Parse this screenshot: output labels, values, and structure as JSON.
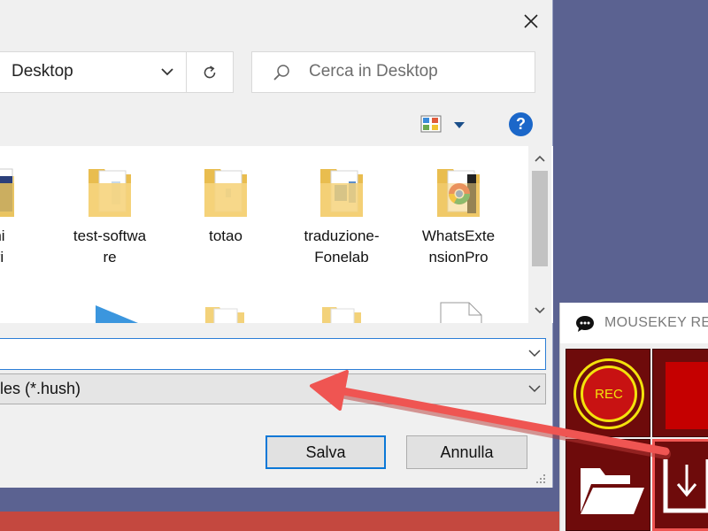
{
  "dialog": {
    "address": {
      "location": "Desktop"
    },
    "search": {
      "placeholder": "Cerca in Desktop"
    },
    "files": [
      {
        "label": "mini\nnari\n:",
        "icon": "document-folder-icon"
      },
      {
        "label": "test-softwa\nre",
        "icon": "folder-icon"
      },
      {
        "label": "totao",
        "icon": "folder-icon"
      },
      {
        "label": "traduzione-\nFonelab",
        "icon": "folder-icon"
      },
      {
        "label": "WhatsExte\nnsionPro",
        "icon": "chrome-folder-icon"
      }
    ],
    "filename": {
      "value": ""
    },
    "filetype": {
      "value": "les (*.hush)"
    },
    "buttons": {
      "save": "Salva",
      "cancel": "Annulla"
    }
  },
  "mousekey": {
    "title": "MOUSEKEY RE",
    "rec_label": "REC"
  },
  "colors": {
    "accent_blue": "#0b78d7",
    "help_blue": "#1b67c9",
    "tile_dark_red": "#6e0b0b",
    "rec_yellow": "#f3e20c",
    "annotation_red": "#ef5552",
    "background": "#5b6291"
  }
}
